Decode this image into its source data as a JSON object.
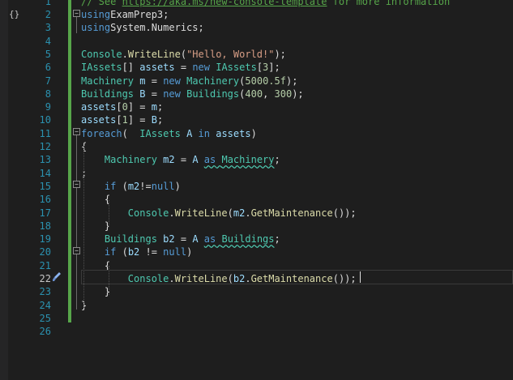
{
  "editor": {
    "top_comment": "// See https://aka.ms/new-console-template for more information",
    "lines": [
      {
        "n": "2",
        "segments": [
          [
            "kw",
            "using"
          ],
          [
            "",
            "ExamPrep3;"
          ]
        ]
      },
      {
        "n": "3",
        "segments": [
          [
            "kw",
            "using"
          ],
          [
            "",
            "System.Numerics;"
          ]
        ]
      },
      {
        "n": "4",
        "segments": []
      },
      {
        "n": "5",
        "segments": [
          [
            "ty",
            "Console"
          ],
          [
            "",
            "."
          ],
          [
            "fn",
            "WriteLine"
          ],
          [
            "",
            "("
          ],
          [
            "str",
            "\"Hello, World!\""
          ],
          [
            "",
            ");"
          ]
        ]
      },
      {
        "n": "6",
        "segments": [
          [
            "ty",
            "IAssets"
          ],
          [
            "",
            "[] "
          ],
          [
            "var",
            "assets"
          ],
          [
            "",
            " = "
          ],
          [
            "kw",
            "new"
          ],
          [
            "",
            " "
          ],
          [
            "ty",
            "IAssets"
          ],
          [
            "",
            "["
          ],
          [
            "num",
            "3"
          ],
          [
            "",
            "];"
          ]
        ]
      },
      {
        "n": "7",
        "segments": [
          [
            "ty",
            "Machinery"
          ],
          [
            "",
            " "
          ],
          [
            "var",
            "m"
          ],
          [
            "",
            " = "
          ],
          [
            "kw",
            "new"
          ],
          [
            "",
            " "
          ],
          [
            "ty",
            "Machinery"
          ],
          [
            "",
            "("
          ],
          [
            "num",
            "500"
          ],
          [
            ", "
          ],
          [
            "num",
            "0.5f"
          ],
          [
            "",
            ");"
          ]
        ]
      },
      {
        "n": "8",
        "segments": [
          [
            "ty",
            "Buildings"
          ],
          [
            "",
            " "
          ],
          [
            "var",
            "B"
          ],
          [
            "",
            " = "
          ],
          [
            "kw",
            "new"
          ],
          [
            "",
            " "
          ],
          [
            "ty",
            "Buildings"
          ],
          [
            "",
            "("
          ],
          [
            "num",
            "400"
          ],
          [
            "",
            ", "
          ],
          [
            "num",
            "300"
          ],
          [
            "",
            ");"
          ]
        ]
      },
      {
        "n": "9",
        "segments": [
          [
            "var",
            "assets"
          ],
          [
            "",
            "["
          ],
          [
            "num",
            "0"
          ],
          [
            "",
            "] = "
          ],
          [
            "var",
            "m"
          ],
          [
            "",
            ";"
          ]
        ]
      },
      {
        "n": "10",
        "segments": [
          [
            "var",
            "assets"
          ],
          [
            "",
            "["
          ],
          [
            "num",
            "1"
          ],
          [
            "",
            "] = "
          ],
          [
            "var",
            "B"
          ],
          [
            "",
            ";"
          ]
        ]
      },
      {
        "n": "11",
        "segments": [
          [
            "kw",
            "foreach"
          ],
          [
            "",
            "(  "
          ],
          [
            "ty",
            "IAssets"
          ],
          [
            "",
            " "
          ],
          [
            "var",
            "A"
          ],
          [
            "",
            " "
          ],
          [
            "kw",
            "in"
          ],
          [
            "",
            " "
          ],
          [
            "var",
            "assets"
          ],
          [
            "",
            ")"
          ]
        ]
      },
      {
        "n": "12",
        "segments": [
          [
            "",
            "{"
          ]
        ]
      },
      {
        "n": "13",
        "segments": [
          [
            "",
            "    "
          ],
          [
            "ty",
            "Machinery"
          ],
          [
            "",
            " "
          ],
          [
            "var",
            "m2"
          ],
          [
            "",
            " = "
          ],
          [
            "var",
            "A"
          ],
          [
            "",
            " "
          ],
          [
            "kw",
            "as"
          ],
          [
            "",
            " "
          ],
          [
            "ty",
            "Machinery"
          ],
          [
            "",
            ";"
          ]
        ]
      },
      {
        "n": "14",
        "segments": [
          [
            "",
            ";"
          ]
        ]
      },
      {
        "n": "15",
        "segments": [
          [
            "",
            "    "
          ],
          [
            "kw",
            "if"
          ],
          [
            "",
            " ("
          ],
          [
            "var",
            "m2"
          ],
          [
            "",
            "!="
          ],
          [
            "kw",
            "null"
          ],
          [
            "",
            ")"
          ]
        ]
      },
      {
        "n": "16",
        "segments": [
          [
            "",
            "    {"
          ]
        ]
      },
      {
        "n": "17",
        "segments": [
          [
            "",
            "        "
          ],
          [
            "ty",
            "Console"
          ],
          [
            "",
            "."
          ],
          [
            "fn",
            "WriteLine"
          ],
          [
            "",
            "("
          ],
          [
            "var",
            "m2"
          ],
          [
            "",
            "."
          ],
          [
            "fn",
            "GetMaintenance"
          ],
          [
            "",
            "());"
          ]
        ]
      },
      {
        "n": "18",
        "segments": [
          [
            "",
            "    }"
          ]
        ]
      },
      {
        "n": "19",
        "segments": [
          [
            "",
            "    "
          ],
          [
            "ty",
            "Buildings"
          ],
          [
            "",
            " "
          ],
          [
            "var",
            "b2"
          ],
          [
            "",
            " = "
          ],
          [
            "var",
            "A"
          ],
          [
            "",
            " "
          ],
          [
            "kw",
            "as"
          ],
          [
            "",
            " "
          ],
          [
            "ty",
            "Buildings"
          ],
          [
            "",
            ";"
          ]
        ]
      },
      {
        "n": "20",
        "segments": [
          [
            "",
            "    "
          ],
          [
            "kw",
            "if"
          ],
          [
            "",
            " ("
          ],
          [
            "var",
            "b2"
          ],
          [
            "",
            " != "
          ],
          [
            "kw",
            "null"
          ],
          [
            "",
            ")"
          ]
        ]
      },
      {
        "n": "21",
        "segments": [
          [
            "",
            "    {"
          ]
        ]
      },
      {
        "n": "22",
        "segments": [
          [
            "",
            "        "
          ],
          [
            "ty",
            "Console"
          ],
          [
            "",
            "."
          ],
          [
            "fn",
            "WriteLine"
          ],
          [
            "",
            "("
          ],
          [
            "var",
            "b2"
          ],
          [
            "",
            "."
          ],
          [
            "fn",
            "GetMaintenance"
          ],
          [
            "",
            "());"
          ]
        ]
      },
      {
        "n": "23",
        "segments": [
          [
            "",
            "    }"
          ]
        ]
      },
      {
        "n": "24",
        "segments": [
          [
            "",
            "}"
          ]
        ]
      },
      {
        "n": "25",
        "segments": []
      },
      {
        "n": "26",
        "segments": []
      }
    ],
    "first_line_number": "1",
    "active_line": "22"
  },
  "colors": {
    "background": "#1e1e1e",
    "keyword": "#569cd6",
    "type": "#4ec9b0",
    "method": "#dcdcaa",
    "string": "#d69d85",
    "number": "#b5cea8",
    "variable": "#9cdcfe",
    "comment": "#57a64a",
    "line_number": "#2b91af"
  },
  "icons": {
    "margin_glyph": "code-block-icon",
    "quick_action": "paintbrush-icon",
    "fold_open": "collapse-minus-icon"
  }
}
